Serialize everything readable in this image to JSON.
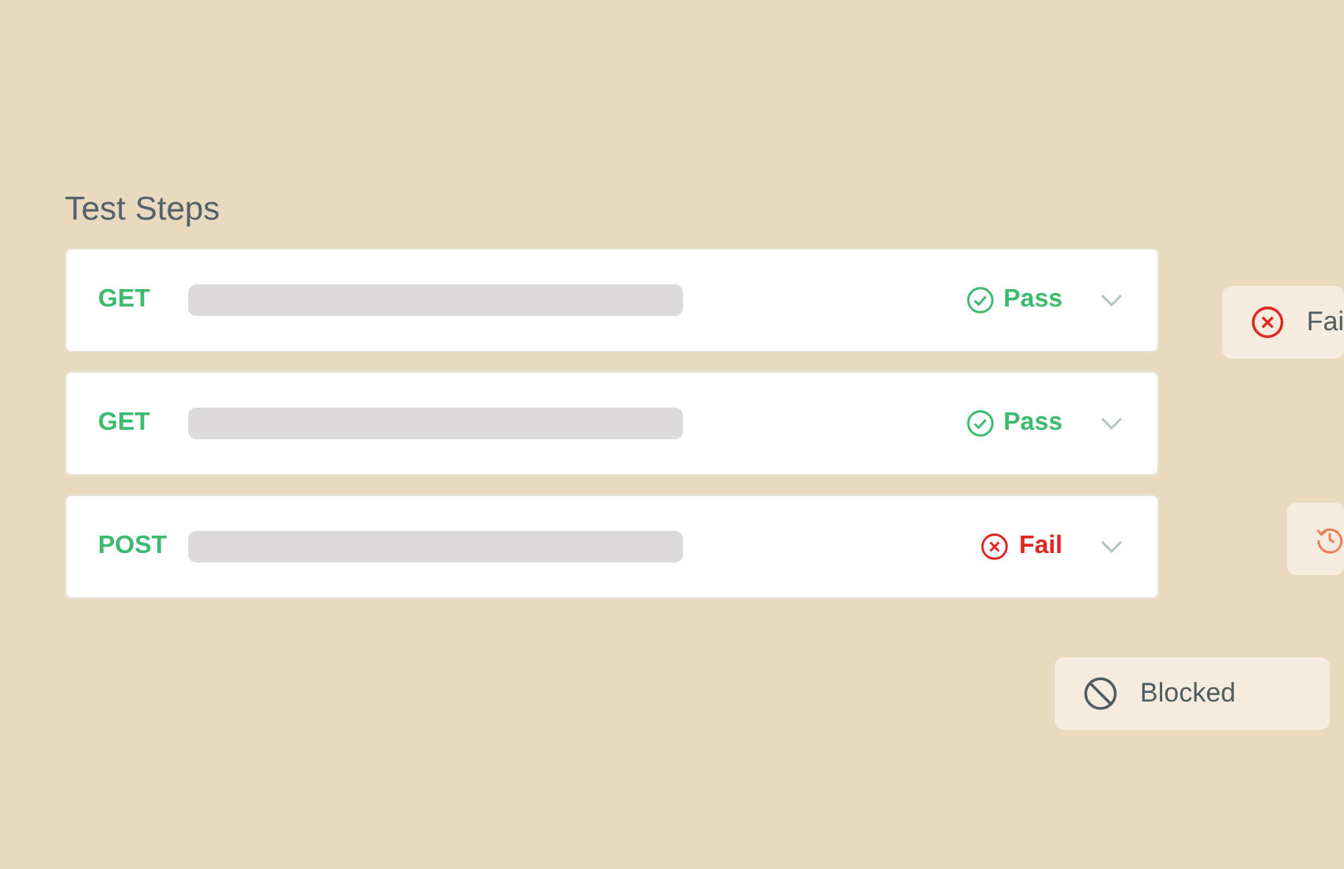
{
  "title": "Test Steps",
  "steps": [
    {
      "method": "GET",
      "status": {
        "kind": "pass",
        "label": "Pass"
      }
    },
    {
      "method": "GET",
      "status": {
        "kind": "pass",
        "label": "Pass"
      }
    },
    {
      "method": "POST",
      "status": {
        "kind": "fail",
        "label": "Fail"
      }
    }
  ],
  "chips": [
    {
      "kind": "fail",
      "label": "Fai"
    },
    {
      "kind": "history"
    },
    {
      "kind": "blocked",
      "label": "Blocked"
    }
  ]
}
